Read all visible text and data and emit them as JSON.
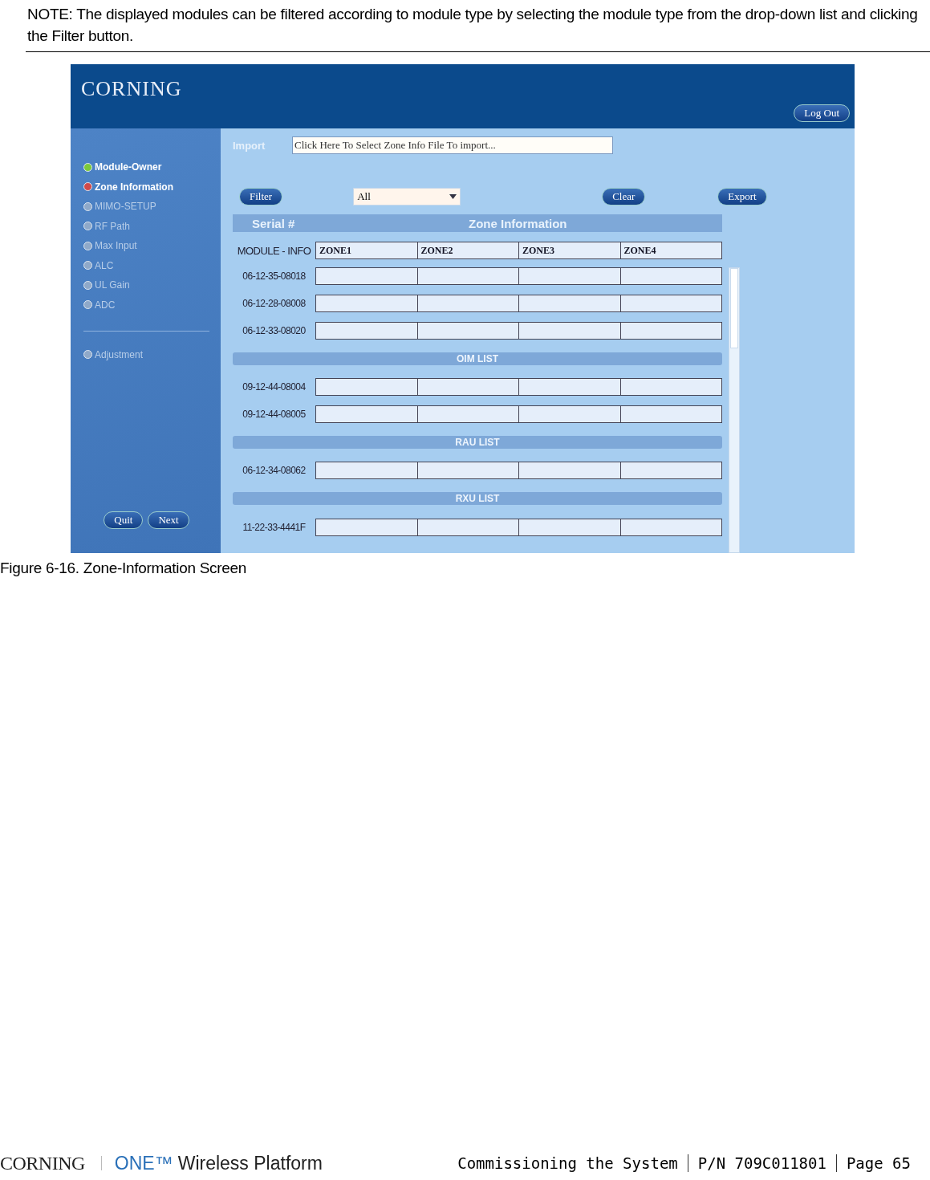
{
  "note": "NOTE: The displayed modules can be filtered according to module type by selecting the module type from the drop-down list and clicking the Filter button.",
  "screen": {
    "logo": "CORNING",
    "logout": "Log Out",
    "nav": [
      {
        "label": "Module-Owner",
        "kind": "done"
      },
      {
        "label": "Zone Information",
        "kind": "current"
      },
      {
        "label": "MIMO-SETUP",
        "kind": "pending"
      },
      {
        "label": "RF Path",
        "kind": "pending"
      },
      {
        "label": "Max Input",
        "kind": "pending"
      },
      {
        "label": "ALC",
        "kind": "pending"
      },
      {
        "label": "UL Gain",
        "kind": "pending"
      },
      {
        "label": "ADC",
        "kind": "pending"
      },
      {
        "label": "Adjustment",
        "kind": "pending",
        "separated": true
      }
    ],
    "nav_buttons": [
      "Quit",
      "Next"
    ],
    "import": {
      "label": "Import",
      "placeholder": "Click Here To Select Zone Info File To import..."
    },
    "toolbar": {
      "filter": "Filter",
      "select_value": "All",
      "clear": "Clear",
      "export": "Export"
    },
    "table": {
      "serial_header": "Serial #",
      "zone_header": "Zone Information",
      "module_label": "MODULE - INFO",
      "columns": [
        "ZONE1",
        "ZONE2",
        "ZONE3",
        "ZONE4"
      ],
      "sections": [
        {
          "rows": [
            "06-12-35-08018",
            "06-12-28-08008",
            "06-12-33-08020"
          ]
        },
        {
          "title": "OIM LIST",
          "rows": [
            "09-12-44-08004",
            "09-12-44-08005"
          ]
        },
        {
          "title": "RAU LIST",
          "rows": [
            "06-12-34-08062"
          ]
        },
        {
          "title": "RXU LIST",
          "rows": [
            "11-22-33-4441F"
          ]
        }
      ]
    }
  },
  "caption": "Figure 6-16. Zone-Information Screen",
  "footer": {
    "logo": "CORNING",
    "brand": "ONE™",
    "product": "Wireless Platform",
    "items": [
      "Commissioning the System",
      "P/N 709C011801",
      "Page 65"
    ]
  }
}
